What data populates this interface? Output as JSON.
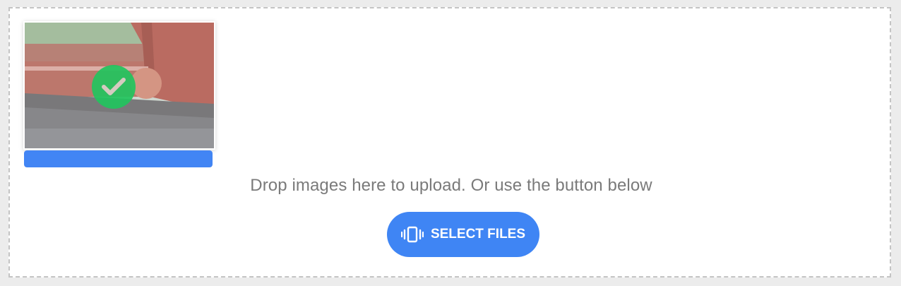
{
  "upload": {
    "hint": "Drop images here to upload. Or use the button below",
    "button_label": "SELECT FILES",
    "button_icon": "vibrate-icon",
    "file": {
      "status": "uploaded",
      "status_icon": "check-icon",
      "progress": 1.0
    }
  },
  "colors": {
    "accent": "#4285f4",
    "success": "#22c55e",
    "hint_text": "#7a7a7a",
    "dash_border": "#c4c4c4"
  }
}
